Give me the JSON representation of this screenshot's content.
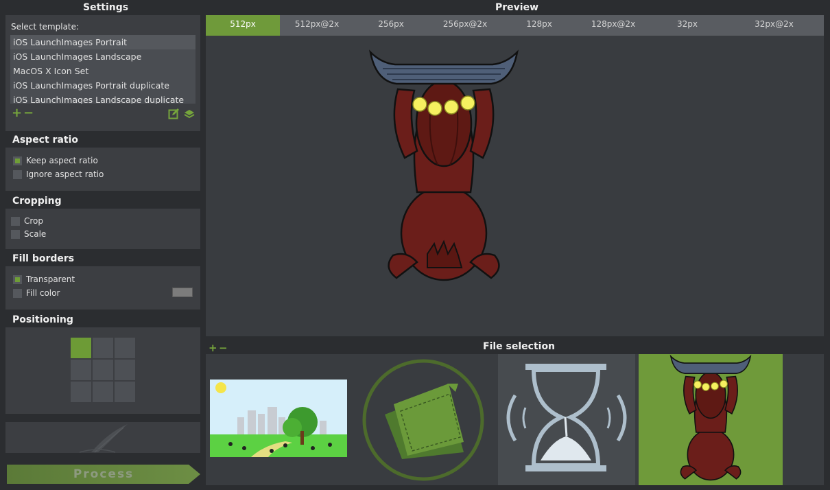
{
  "settings": {
    "title": "Settings",
    "select_template_label": "Select template:",
    "templates": [
      "iOS LaunchImages Portrait",
      "iOS LaunchImages Landscape",
      "MacOS X Icon Set",
      "iOS LaunchImages Portrait duplicate",
      "iOS LaunchImages Landscape duplicate"
    ],
    "template_tools": {
      "add": "+",
      "remove": "−"
    }
  },
  "aspect_ratio": {
    "title": "Aspect ratio",
    "options": [
      "Keep aspect ratio",
      "Ignore aspect ratio"
    ],
    "selected": "Keep aspect ratio"
  },
  "cropping": {
    "title": "Cropping",
    "options": [
      "Crop",
      "Scale"
    ]
  },
  "fill_borders": {
    "title": "Fill borders",
    "options": [
      "Transparent",
      "Fill color"
    ],
    "selected": "Transparent",
    "fill_color": "#7c7c7c"
  },
  "positioning": {
    "title": "Positioning",
    "selected_cell": 0
  },
  "process_button": "Process",
  "preview": {
    "title": "Preview",
    "tabs": [
      "512px",
      "512px@2x",
      "256px",
      "256px@2x",
      "128px",
      "128px@2x",
      "32px",
      "32px@2x"
    ],
    "active_tab": "512px"
  },
  "file_selection": {
    "title": "File selection",
    "add": "+",
    "remove": "−",
    "files": [
      "park-scene",
      "resize-logo",
      "hourglass",
      "dog-with-basket"
    ]
  },
  "colors": {
    "accent": "#6f9a3a",
    "background": "#2b2d30",
    "panel": "#3c3e42"
  }
}
